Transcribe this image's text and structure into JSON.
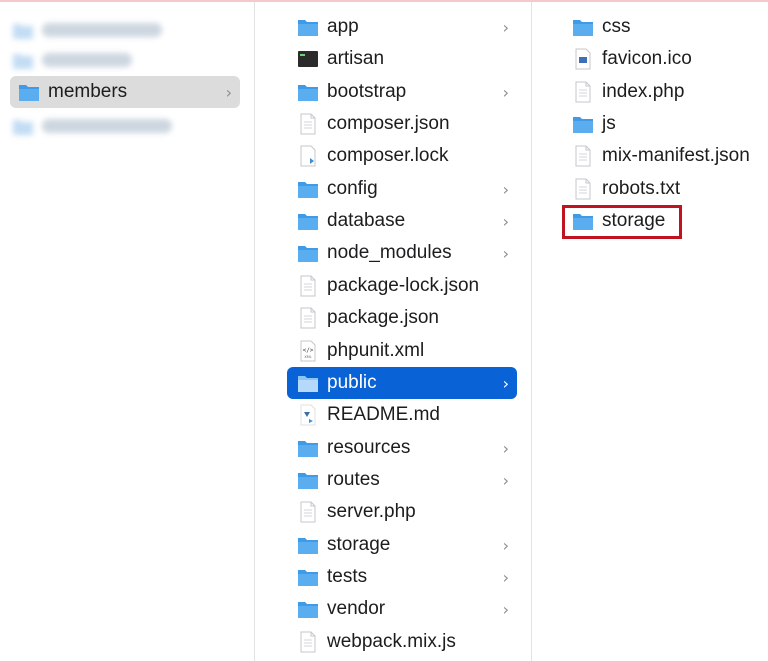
{
  "colors": {
    "folder": "#5aaef0",
    "selection": "#0a63d6",
    "highlight": "#c1121f"
  },
  "sidebar": {
    "items": [
      {
        "label": "members",
        "icon": "folder-icon",
        "selected": true,
        "chevron": "›"
      }
    ]
  },
  "column2": {
    "items": [
      {
        "label": "app",
        "icon": "folder-icon",
        "chevron": "›"
      },
      {
        "label": "artisan",
        "icon": "terminal-icon",
        "chevron": ""
      },
      {
        "label": "bootstrap",
        "icon": "folder-icon",
        "chevron": "›"
      },
      {
        "label": "composer.json",
        "icon": "document-icon",
        "chevron": ""
      },
      {
        "label": "composer.lock",
        "icon": "lock-document-icon",
        "chevron": ""
      },
      {
        "label": "config",
        "icon": "folder-icon",
        "chevron": "›"
      },
      {
        "label": "database",
        "icon": "folder-icon",
        "chevron": "›"
      },
      {
        "label": "node_modules",
        "icon": "folder-icon",
        "chevron": "›"
      },
      {
        "label": "package-lock.json",
        "icon": "document-icon",
        "chevron": ""
      },
      {
        "label": "package.json",
        "icon": "document-icon",
        "chevron": ""
      },
      {
        "label": "phpunit.xml",
        "icon": "xml-document-icon",
        "chevron": ""
      },
      {
        "label": "public",
        "icon": "folder-icon",
        "chevron": "›",
        "selected": true
      },
      {
        "label": "README.md",
        "icon": "markdown-document-icon",
        "chevron": ""
      },
      {
        "label": "resources",
        "icon": "folder-icon",
        "chevron": "›"
      },
      {
        "label": "routes",
        "icon": "folder-icon",
        "chevron": "›"
      },
      {
        "label": "server.php",
        "icon": "document-icon",
        "chevron": ""
      },
      {
        "label": "storage",
        "icon": "folder-icon",
        "chevron": "›"
      },
      {
        "label": "tests",
        "icon": "folder-icon",
        "chevron": "›"
      },
      {
        "label": "vendor",
        "icon": "folder-icon",
        "chevron": "›"
      },
      {
        "label": "webpack.mix.js",
        "icon": "document-icon",
        "chevron": ""
      }
    ]
  },
  "column3": {
    "items": [
      {
        "label": "css",
        "icon": "folder-icon"
      },
      {
        "label": "favicon.ico",
        "icon": "image-document-icon"
      },
      {
        "label": "index.php",
        "icon": "document-icon"
      },
      {
        "label": "js",
        "icon": "folder-icon"
      },
      {
        "label": "mix-manifest.json",
        "icon": "document-icon"
      },
      {
        "label": "robots.txt",
        "icon": "document-icon"
      },
      {
        "label": "storage",
        "icon": "folder-icon",
        "highlighted": true
      }
    ]
  }
}
